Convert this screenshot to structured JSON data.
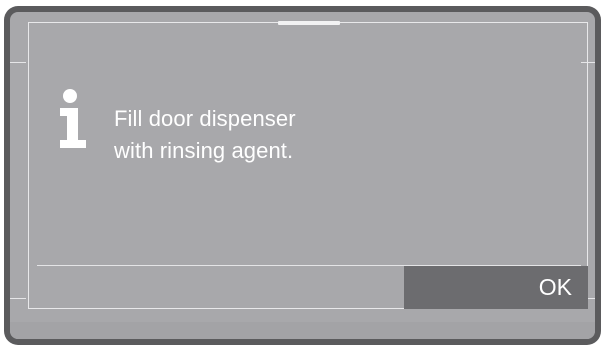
{
  "dialog": {
    "icon": "info-icon",
    "message_line1": "Fill door dispenser",
    "message_line2": "with rinsing agent.",
    "ok_label": "OK"
  },
  "colors": {
    "bezel": "#5b5b5d",
    "screen": "#a8a8ab",
    "button": "#6c6c6f",
    "text": "#ffffff"
  }
}
